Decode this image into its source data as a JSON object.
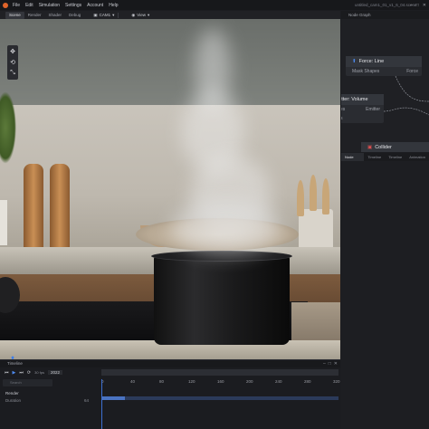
{
  "menu": {
    "items": [
      "File",
      "Edit",
      "Simulation",
      "Settings",
      "Account",
      "Help"
    ],
    "document_title": "untitled_cam1_01_v1_6_04.scene"
  },
  "toolbar": {
    "tabs": [
      "Scene",
      "Render",
      "Shader",
      "Debug"
    ],
    "active_tab": "Scene",
    "camera": "CAM1",
    "view": "View"
  },
  "viewport": {
    "tools": [
      "move-icon",
      "rotate-icon",
      "scale-icon"
    ]
  },
  "node_graph": {
    "title": "Node Graph",
    "nodes": [
      {
        "title": "Force: Line",
        "rows": [
          {
            "left": "Mask Shapes",
            "right": "Force"
          }
        ]
      },
      {
        "title": "itter: Volume",
        "rows": [
          {
            "left": "es",
            "right": "Emitter"
          },
          {
            "left": "s",
            "right": ""
          }
        ]
      },
      {
        "title": "Collider",
        "rows": []
      }
    ]
  },
  "panel_tabs": [
    "Node Details",
    "Timeline",
    "Timeline",
    "Animation"
  ],
  "timeline": {
    "title": "Timeline",
    "fps_label": "30 fps",
    "frame": "2022",
    "ruler_marks": [
      "0",
      "40",
      "80",
      "120",
      "160",
      "200",
      "240",
      "280",
      "320"
    ],
    "search_placeholder": "Search",
    "tracks": [
      {
        "name": "Render",
        "value": ""
      },
      {
        "name": "Duration",
        "value": "64"
      }
    ],
    "progress": 0.1
  },
  "colors": {
    "accent": "#3d6fd1",
    "logo": "#e0642a",
    "panel_bg": "#1f2024"
  }
}
